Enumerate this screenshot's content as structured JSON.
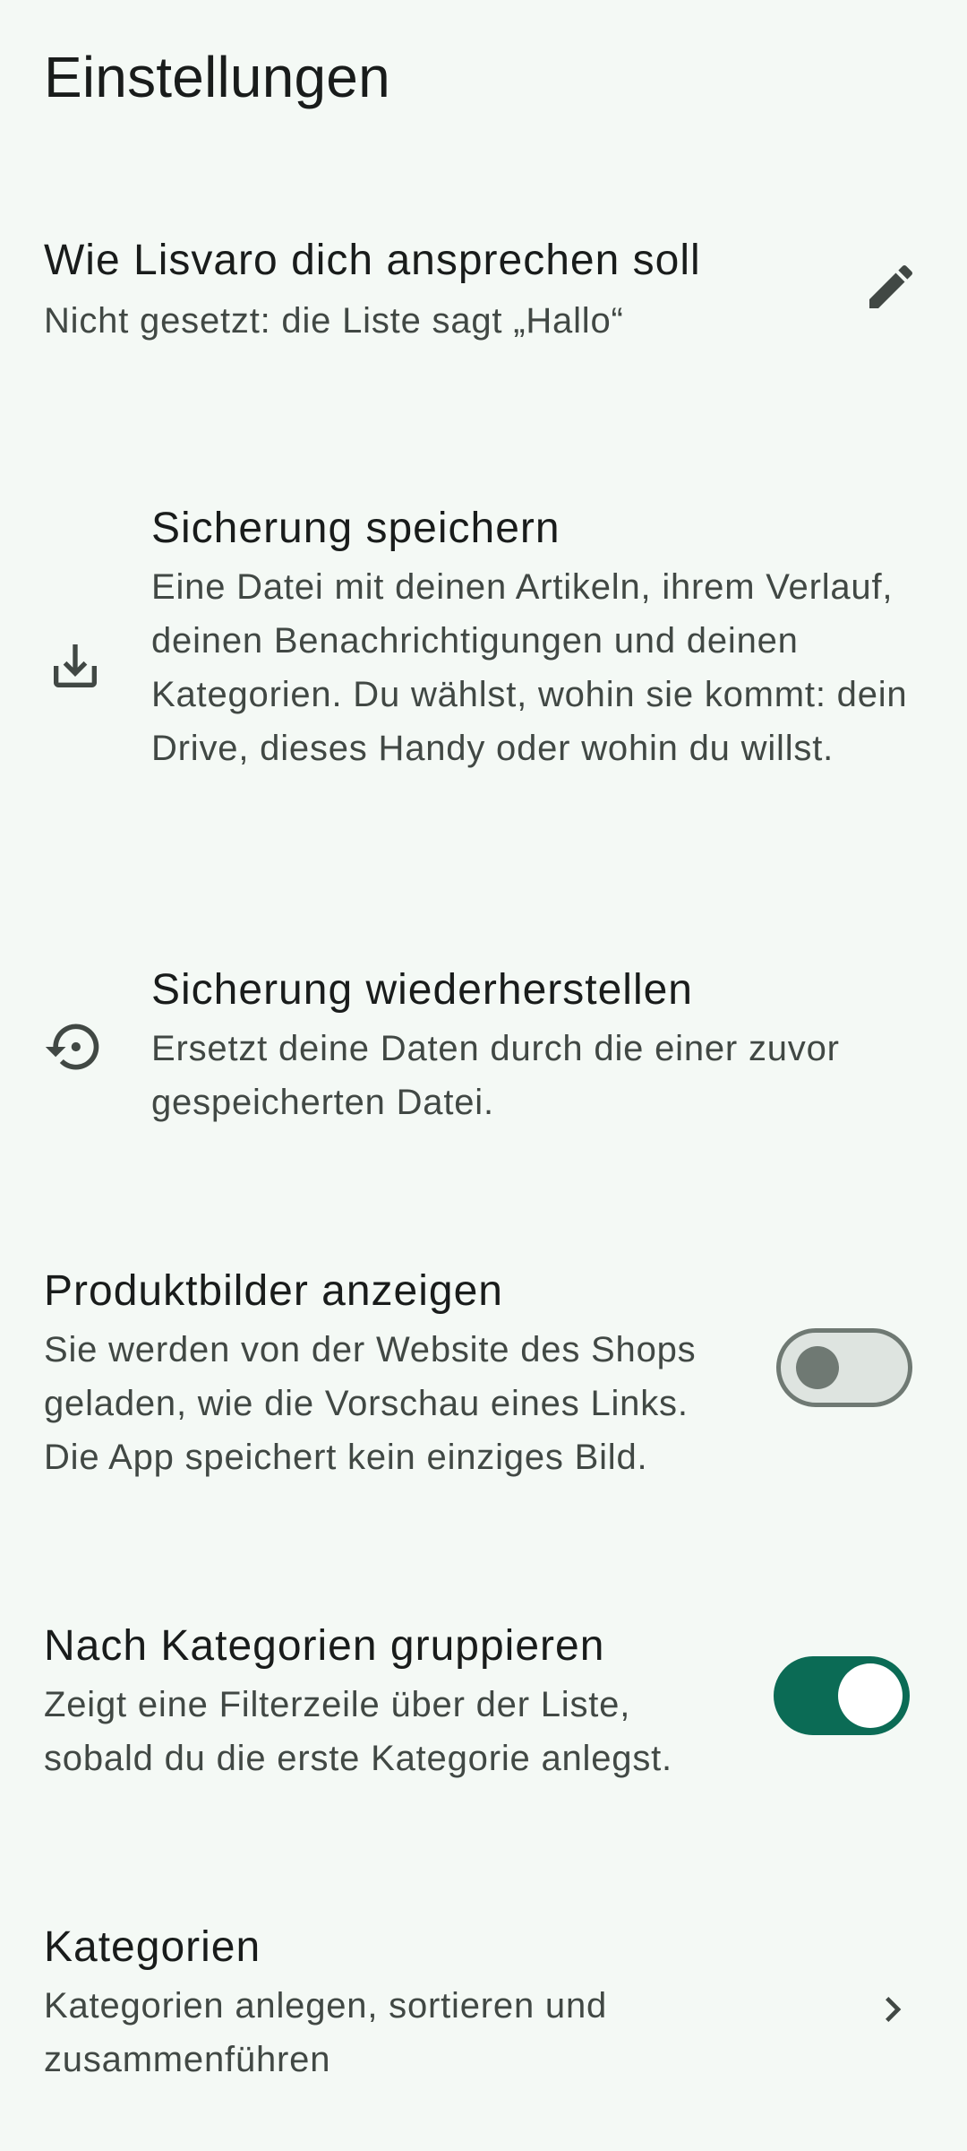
{
  "page": {
    "title": "Einstellungen"
  },
  "settings": {
    "name": {
      "title": "Wie Lisvaro dich ansprechen soll",
      "description": "Nicht gesetzt: die Liste sagt „Hallo“",
      "icon": "edit-pencil-icon"
    },
    "backup_save": {
      "title": "Sicherung speichern",
      "description": "Eine Datei mit deinen Artikeln, ihrem Verlauf, deinen Benachrichtigungen und deinen Kategorien. Du wählst, wohin sie kommt: dein Drive, dieses Handy oder wohin du willst.",
      "icon": "download-icon"
    },
    "backup_restore": {
      "title": "Sicherung wiederherstellen",
      "description": "Ersetzt deine Daten durch die einer zuvor gespeicherten Datei.",
      "icon": "restore-icon"
    },
    "product_images": {
      "title": "Produktbilder anzeigen",
      "description": "Sie werden von der Website des Shops geladen, wie die Vorschau eines Links. Die App speichert kein einziges Bild.",
      "enabled": false
    },
    "group_by_category": {
      "title": "Nach Kategorien gruppieren",
      "description": "Zeigt eine Filterzeile über der Liste, sobald du die erste Kategorie anlegst.",
      "enabled": true
    },
    "categories": {
      "title": "Kategorien",
      "description": "Kategorien anlegen, sortieren und zusammenführen",
      "icon": "chevron-right-icon"
    }
  },
  "colors": {
    "background": "#f4f9f5",
    "accent": "#0b6b55",
    "text_primary": "#191c1b",
    "text_secondary": "#414844"
  }
}
